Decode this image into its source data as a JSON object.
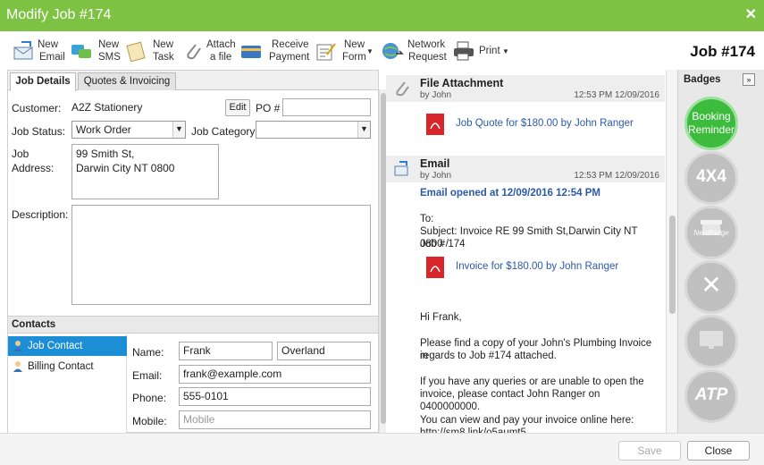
{
  "window": {
    "title": "Modify Job #174",
    "close_glyph": "✕"
  },
  "toolbar": {
    "new_email": [
      "New",
      "Email"
    ],
    "new_sms": [
      "New",
      "SMS"
    ],
    "new_task": [
      "New",
      "Task"
    ],
    "attach_file": [
      "Attach",
      "a file"
    ],
    "receive_payment": [
      "Receive",
      "Payment"
    ],
    "new_form": [
      "New",
      "Form"
    ],
    "network_request": [
      "Network",
      "Request"
    ],
    "print": "Print",
    "job_heading": "Job #174"
  },
  "tabs": {
    "job_details": "Job Details",
    "quotes_invoicing": "Quotes & Invoicing"
  },
  "form": {
    "customer_label": "Customer:",
    "customer_value": "A2Z Stationery",
    "edit_label": "Edit",
    "po_label": "PO #",
    "po_value": "",
    "job_status_label": "Job Status:",
    "job_status_value": "Work Order",
    "job_category_label": "Job Category",
    "job_category_value": "",
    "job_address_label": [
      "Job",
      "Address:"
    ],
    "job_address_lines": [
      "99 Smith St,",
      "Darwin City NT 0800"
    ],
    "description_label": "Description:",
    "description_value": ""
  },
  "contacts": {
    "heading": "Contacts",
    "items": [
      "Job Contact",
      "Billing Contact"
    ],
    "name_label": "Name:",
    "first_name": "Frank",
    "last_name": "Overland",
    "email_label": "Email:",
    "email_value": "frank@example.com",
    "phone_label": "Phone:",
    "phone_value": "555-0101",
    "mobile_label": "Mobile:",
    "mobile_placeholder": "Mobile"
  },
  "activity": [
    {
      "type": "File Attachment",
      "by": "by John",
      "time": "12:53 PM 12/09/2016",
      "attachment": "Job Quote for $180.00 by John Ranger"
    },
    {
      "type": "Email",
      "by": "by John",
      "time": "12:53 PM 12/09/2016",
      "opened": "Email opened at 12/09/2016 12:54 PM",
      "to": "To:",
      "subject_lines": [
        "Subject: Invoice RE 99 Smith St,Darwin City NT 0800 /",
        "Job # 174"
      ],
      "attachment": "Invoice for $180.00 by John Ranger",
      "greeting": "Hi Frank,",
      "body1": [
        "Please find a copy of your John's Plumbing Invoice in",
        "regards to Job #174 attached."
      ],
      "body2": [
        "If you have any queries or are unable to open the",
        "invoice, please contact John Ranger on 0400000000."
      ],
      "body3": [
        "You can view and pay your invoice online here:",
        "http://sm8.link/o5aumt5"
      ]
    }
  ],
  "badges": {
    "heading": "Badges",
    "expand_glyph": "»",
    "items": [
      {
        "label": "Booking Reminder",
        "active": true
      },
      {
        "label": "4X4",
        "active": false
      },
      {
        "label": "NewBadge",
        "active": false
      },
      {
        "label": "✕",
        "active": false
      },
      {
        "label": "",
        "active": false
      },
      {
        "label": "ATP",
        "active": false
      }
    ]
  },
  "footer": {
    "save": "Save",
    "close": "Close"
  },
  "colors": {
    "title_bar": "#7dc242",
    "accent_blue": "#1b8ed6",
    "link_blue": "#2b5aa8",
    "badge_active": "#3dbb3d",
    "badge_inactive": "#c0c0c0"
  }
}
